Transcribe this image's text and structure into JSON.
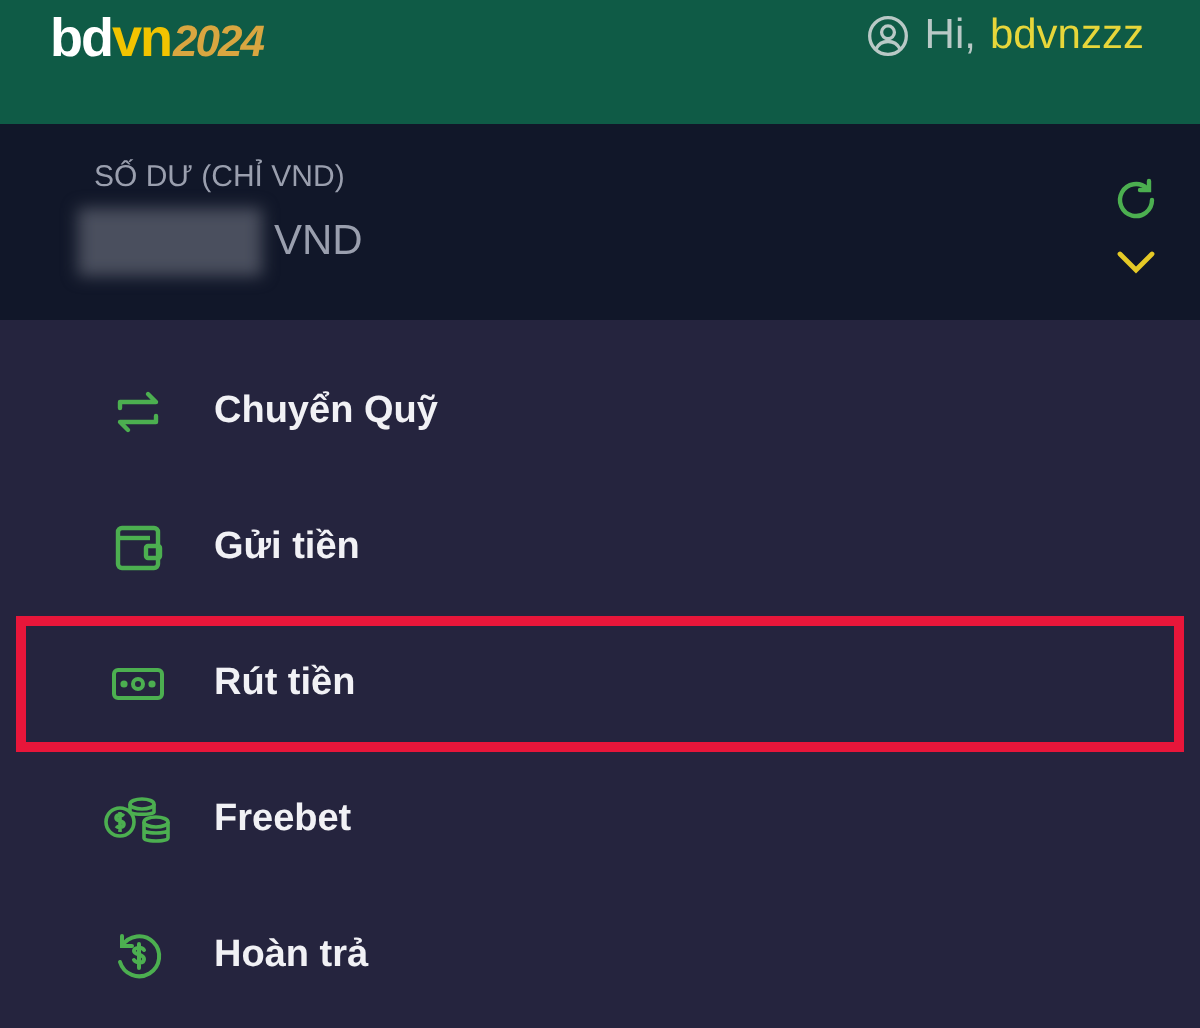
{
  "header": {
    "logo": {
      "primary": "bd",
      "accent": "vn",
      "year": "2024"
    },
    "greeting": "Hi,",
    "username": "bdvnzzz"
  },
  "balance": {
    "label": "SỐ DƯ (CHỈ VND)",
    "currency": "VND",
    "amount_hidden": true
  },
  "menu": [
    {
      "kind": "transfer",
      "label": "Chuyển Quỹ",
      "highlighted": false
    },
    {
      "kind": "wallet",
      "label": "Gửi tiền",
      "highlighted": false
    },
    {
      "kind": "cash",
      "label": "Rút tiền",
      "highlighted": true
    },
    {
      "kind": "coins",
      "label": "Freebet",
      "highlighted": false
    },
    {
      "kind": "refund",
      "label": "Hoàn trả",
      "highlighted": false
    }
  ]
}
